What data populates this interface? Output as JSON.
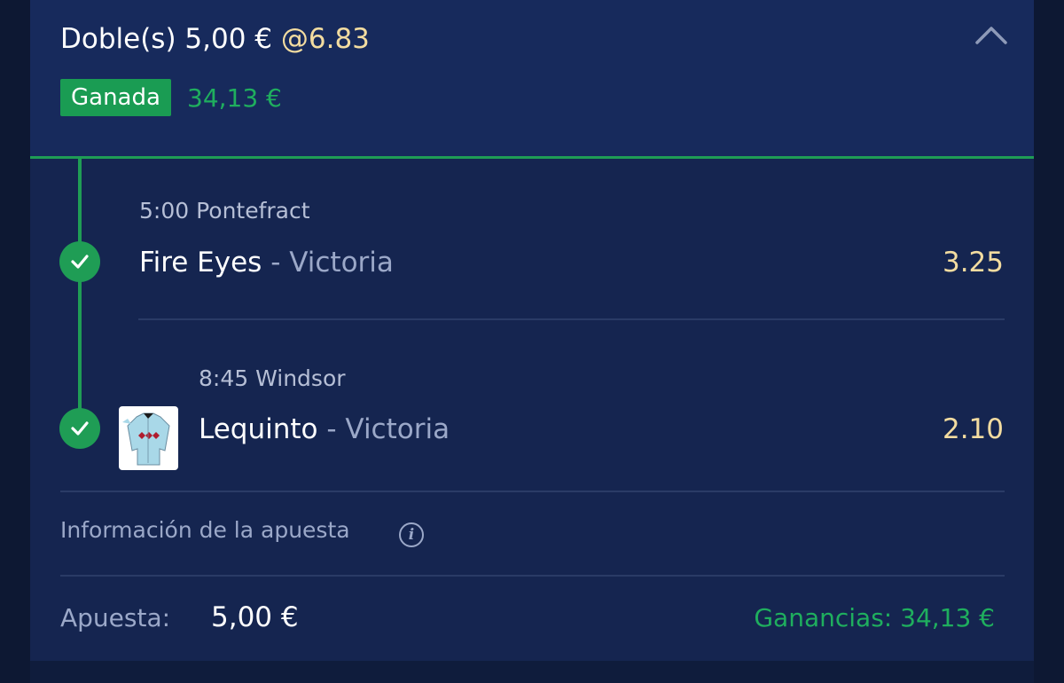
{
  "bet": {
    "type_label": "Doble(s)",
    "stake": "5,00 €",
    "odds": "@6.83",
    "status": "Ganada",
    "win_amount": "34,13 €"
  },
  "legs": [
    {
      "event": "5:00 Pontefract",
      "selection": "Fire Eyes",
      "separator": " - ",
      "result": "Victoria",
      "price": "3.25",
      "icon": "check-icon"
    },
    {
      "event": "8:45 Windsor",
      "selection": "Lequinto",
      "separator": " - ",
      "result": "Victoria",
      "price": "2.10",
      "icon": "check-icon",
      "silk": "jockey-silk-icon"
    }
  ],
  "info": {
    "label": "Información de la apuesta",
    "icon": "info-icon",
    "icon_glyph": "i"
  },
  "summary": {
    "stake_label": "Apuesta:",
    "stake_value": "5,00 €",
    "winnings_label": "Ganancias:",
    "winnings_value": "34,13 €"
  },
  "colors": {
    "accent_green": "#1f9d55",
    "odds_gold": "#f3dca0",
    "background": "#152550"
  }
}
